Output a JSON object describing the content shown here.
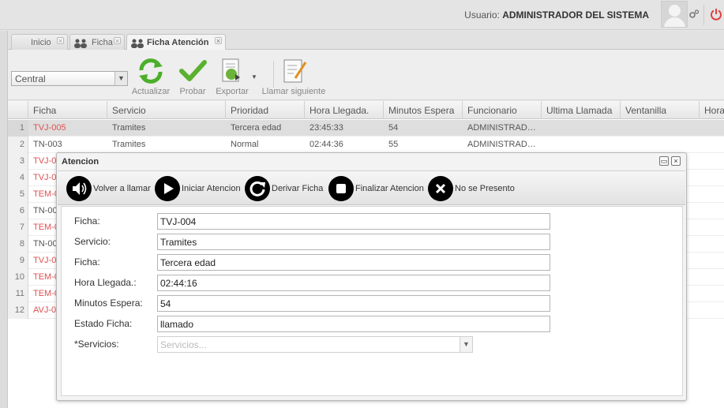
{
  "header": {
    "user_label": "Usuario:",
    "user_name": "ADMINISTRADOR DEL SISTEMA"
  },
  "tabs": [
    {
      "label": "Inicio"
    },
    {
      "label": "Ficha"
    },
    {
      "label": "Ficha Atención"
    }
  ],
  "toolbar": {
    "central_value": "Central",
    "buttons": [
      {
        "label": "Actualizar",
        "icon": "refresh-icon"
      },
      {
        "label": "Probar",
        "icon": "check-icon"
      },
      {
        "label": "Exportar",
        "icon": "export-icon"
      },
      {
        "label": "Llamar siguiente",
        "icon": "call-next-icon"
      }
    ]
  },
  "grid": {
    "columns": [
      "Ficha",
      "Servicio",
      "Prioridad",
      "Hora Llegada.",
      "Minutos Espera",
      "Funcionario",
      "Ultima Llamada",
      "Ventanilla",
      "Hora"
    ],
    "rows": [
      {
        "num": "1",
        "ficha": "TVJ-005",
        "servicio": "Tramites",
        "prioridad": "Tercera edad",
        "hora": "23:45:33",
        "minutos": "54",
        "funcionario": "ADMINISTRAD…"
      },
      {
        "num": "2",
        "ficha": "TN-003",
        "servicio": "Tramites",
        "prioridad": "Normal",
        "hora": "02:44:36",
        "minutos": "55",
        "funcionario": "ADMINISTRAD…"
      },
      {
        "num": "3",
        "ficha": "TVJ-0"
      },
      {
        "num": "4",
        "ficha": "TVJ-0"
      },
      {
        "num": "5",
        "ficha": "TEM-0"
      },
      {
        "num": "6",
        "ficha": "TN-00"
      },
      {
        "num": "7",
        "ficha": "TEM-0"
      },
      {
        "num": "8",
        "ficha": "TN-00"
      },
      {
        "num": "9",
        "ficha": "TVJ-0"
      },
      {
        "num": "10",
        "ficha": "TEM-0"
      },
      {
        "num": "11",
        "ficha": "TEM-0"
      },
      {
        "num": "12",
        "ficha": "AVJ-0"
      }
    ]
  },
  "modal": {
    "title": "Atencion",
    "actions": [
      {
        "label": "Volver a llamar",
        "icon": "speaker-icon"
      },
      {
        "label": "Iniciar Atencion",
        "icon": "play-icon"
      },
      {
        "label": "Derivar Ficha",
        "icon": "redirect-icon"
      },
      {
        "label": "Finalizar Atencion",
        "icon": "stop-icon"
      },
      {
        "label": "No se Presento",
        "icon": "close-x-icon"
      }
    ],
    "fields": [
      {
        "label": "Ficha:",
        "value": "TVJ-004"
      },
      {
        "label": "Servicio:",
        "value": "Tramites"
      },
      {
        "label": "Ficha:",
        "value": "Tercera edad"
      },
      {
        "label": "Hora Llegada.:",
        "value": "02:44:16"
      },
      {
        "label": "Minutos Espera:",
        "value": "54"
      },
      {
        "label": "Estado Ficha:",
        "value": "llamado"
      }
    ],
    "servicios_label": "*Servicios:",
    "servicios_placeholder": "Servicios..."
  }
}
